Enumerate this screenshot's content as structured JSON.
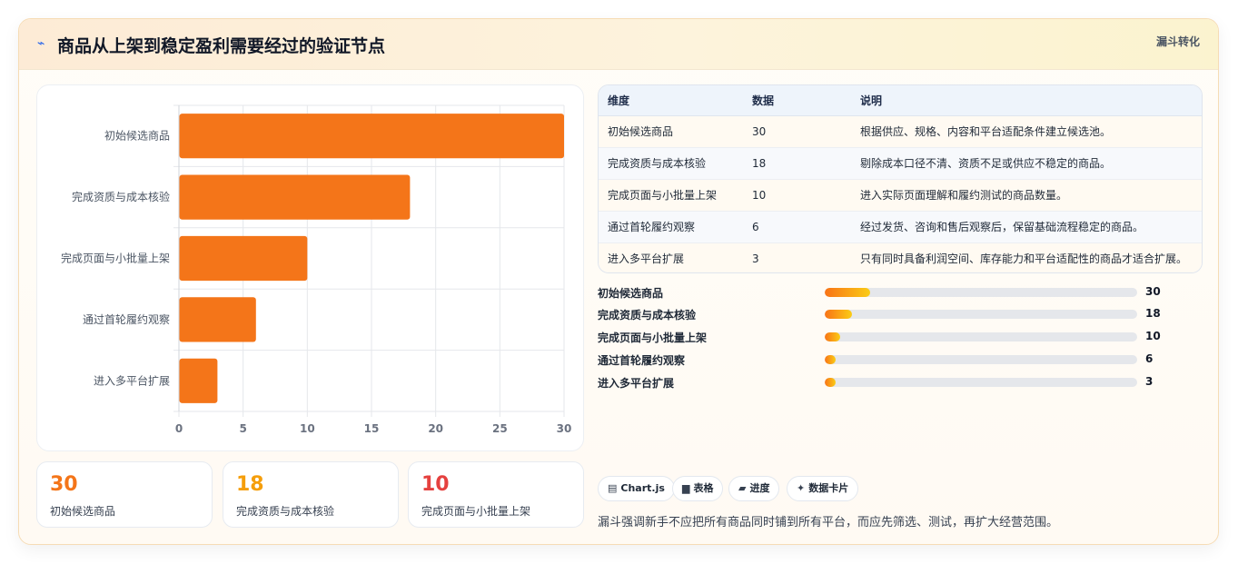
{
  "header": {
    "title": "商品从上架到稳定盈利需要经过的验证节点",
    "tag": "漏斗转化",
    "icon": "lightning-icon"
  },
  "chart_data": {
    "type": "bar",
    "orientation": "horizontal",
    "categories": [
      "初始候选商品",
      "完成资质与成本核验",
      "完成页面与小批量上架",
      "通过首轮履约观察",
      "进入多平台扩展"
    ],
    "values": [
      30,
      18,
      10,
      6,
      3
    ],
    "xlim": [
      0,
      30
    ],
    "xticks": [
      "0",
      "5",
      "10",
      "15",
      "20",
      "25",
      "30"
    ],
    "bar_color": "#f47519",
    "grid": true
  },
  "stats": [
    {
      "value": "30",
      "label": "初始候选商品",
      "color": "#f47519"
    },
    {
      "value": "18",
      "label": "完成资质与成本核验",
      "color": "#f59e0b"
    },
    {
      "value": "10",
      "label": "完成页面与小批量上架",
      "color": "#e5413f"
    }
  ],
  "table": {
    "headers": [
      "维度",
      "数据",
      "说明"
    ],
    "rows": [
      [
        "初始候选商品",
        "30",
        "根据供应、规格、内容和平台适配条件建立候选池。"
      ],
      [
        "完成资质与成本核验",
        "18",
        "剔除成本口径不清、资质不足或供应不稳定的商品。"
      ],
      [
        "完成页面与小批量上架",
        "10",
        "进入实际页面理解和履约测试的商品数量。"
      ],
      [
        "通过首轮履约观察",
        "6",
        "经过发货、咨询和售后观察后，保留基础流程稳定的商品。"
      ],
      [
        "进入多平台扩展",
        "3",
        "只有同时具备利润空间、库存能力和平台适配性的商品才适合扩展。"
      ]
    ]
  },
  "progress": {
    "max": 30,
    "items": [
      {
        "label": "初始候选商品",
        "value": 30,
        "fill": 0.145
      },
      {
        "label": "完成资质与成本核验",
        "value": 18,
        "fill": 0.087
      },
      {
        "label": "完成页面与小批量上架",
        "value": 10,
        "fill": 0.048
      },
      {
        "label": "通过首轮履约观察",
        "value": 6,
        "fill": 0.035
      },
      {
        "label": "进入多平台扩展",
        "value": 3,
        "fill": 0.035
      }
    ]
  },
  "chips": [
    {
      "icon": "chart-icon",
      "glyph": "▤",
      "label": "Chart.js"
    },
    {
      "icon": "table-icon",
      "glyph": "▆",
      "label": "表格"
    },
    {
      "icon": "progress-icon",
      "glyph": "▰",
      "label": "进度"
    },
    {
      "icon": "sparkle-icon",
      "glyph": "✦",
      "label": "数据卡片"
    }
  ],
  "footnote": "漏斗强调新手不应把所有商品同时铺到所有平台，而应先筛选、测试，再扩大经营范围。"
}
